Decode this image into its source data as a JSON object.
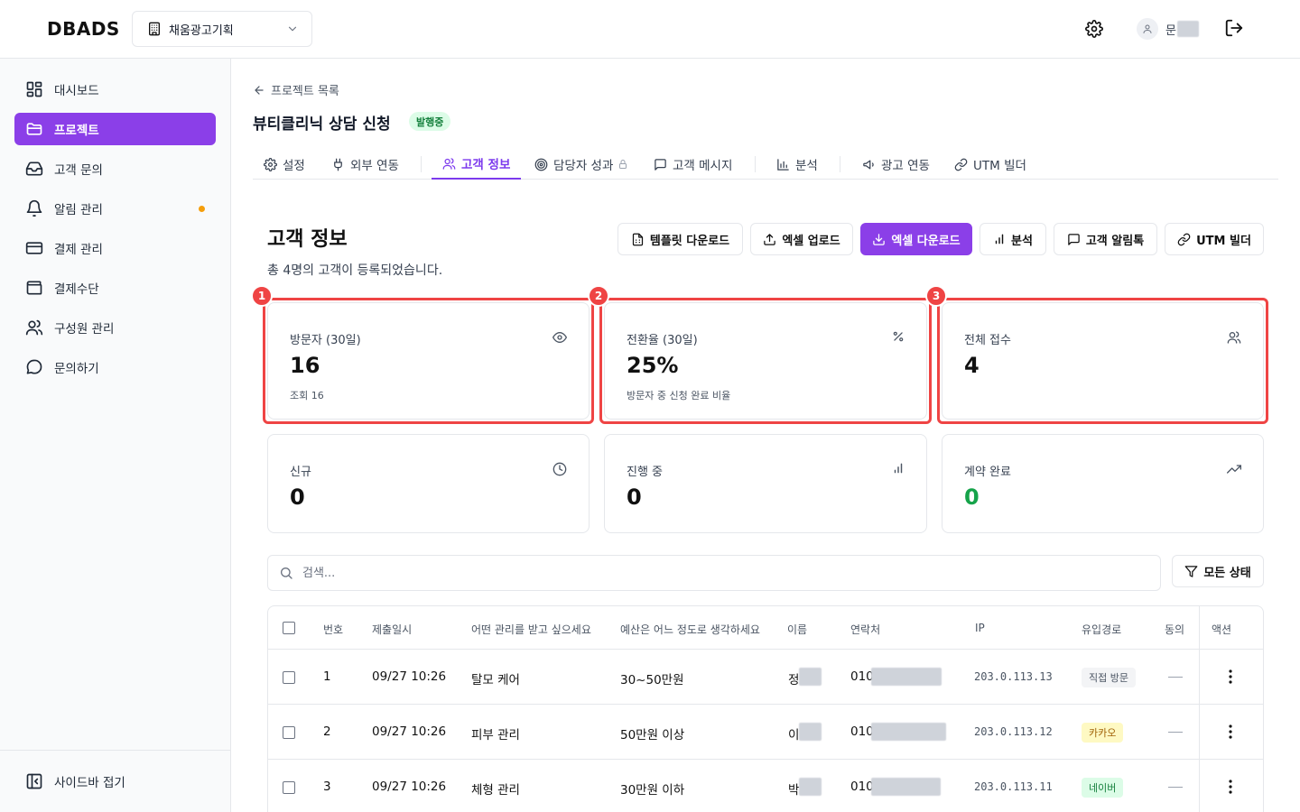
{
  "app": {
    "logo": "DBADS"
  },
  "header": {
    "org_name": "채움광고기획",
    "user_initial": "문"
  },
  "sidebar": {
    "items": [
      {
        "label": "대시보드",
        "icon": "dashboard-icon"
      },
      {
        "label": "프로젝트",
        "icon": "folder-icon",
        "active": true
      },
      {
        "label": "고객 문의",
        "icon": "inbox-icon"
      },
      {
        "label": "알림 관리",
        "icon": "bell-icon",
        "dot": true
      },
      {
        "label": "결제 관리",
        "icon": "card-icon"
      },
      {
        "label": "결제수단",
        "icon": "wallet-icon"
      },
      {
        "label": "구성원 관리",
        "icon": "users-icon"
      },
      {
        "label": "문의하기",
        "icon": "chat-icon"
      }
    ],
    "collapse_label": "사이드바 접기"
  },
  "project": {
    "back_label": "프로젝트 목록",
    "title": "뷰티클리닉 상담 신청",
    "status": "발행중"
  },
  "tabs": [
    {
      "label": "설정"
    },
    {
      "label": "외부 연동"
    },
    {
      "label": "고객 정보",
      "active": true
    },
    {
      "label": "담당자 성과"
    },
    {
      "label": "고객 메시지"
    },
    {
      "label": "분석"
    },
    {
      "label": "광고 연동"
    },
    {
      "label": "UTM 빌더"
    }
  ],
  "section": {
    "title": "고객 정보",
    "subtitle": "총 4명의 고객이 등록되었습니다."
  },
  "actions": {
    "template_download": "템플릿 다운로드",
    "excel_upload": "엑셀 업로드",
    "excel_download": "엑셀 다운로드",
    "analysis": "분석",
    "alimtalk": "고객 알림톡",
    "utm_builder": "UTM 빌더"
  },
  "stats": {
    "visitors": {
      "label": "방문자 (30일)",
      "value": "16",
      "sub": "조회 16"
    },
    "conversion": {
      "label": "전환율 (30일)",
      "value": "25%",
      "sub": "방문자 중 신청 완료 비율"
    },
    "total": {
      "label": "전체 접수",
      "value": "4"
    },
    "new": {
      "label": "신규",
      "value": "0"
    },
    "in_progress": {
      "label": "진행 중",
      "value": "0"
    },
    "contracted": {
      "label": "계약 완료",
      "value": "0"
    }
  },
  "highlights": [
    "1",
    "2",
    "3"
  ],
  "search": {
    "placeholder": "검색..."
  },
  "filter": {
    "label": "모든 상태"
  },
  "table": {
    "headers": {
      "no": "번호",
      "submitted": "제출일시",
      "q1": "어떤 관리를 받고 싶으세요",
      "q2": "예산은 어느 정도로 생각하세요",
      "name": "이름",
      "contact": "연락처",
      "ip": "IP",
      "source": "유입경로",
      "consent": "동의",
      "action": "액션"
    },
    "rows": [
      {
        "no": "1",
        "submitted": "09/27 10:26",
        "q1": "탈모 케어",
        "q2": "30~50만원",
        "name": "정",
        "contact": "010",
        "ip": "203.0.113.13",
        "source": "직접 방문"
      },
      {
        "no": "2",
        "submitted": "09/27 10:26",
        "q1": "피부 관리",
        "q2": "50만원 이상",
        "name": "이",
        "contact": "010",
        "ip": "203.0.113.12",
        "source": "카카오"
      },
      {
        "no": "3",
        "submitted": "09/27 10:26",
        "q1": "체형 관리",
        "q2": "30만원 이하",
        "name": "박",
        "contact": "010",
        "ip": "203.0.113.11",
        "source": "네이버"
      }
    ]
  },
  "colors": {
    "accent": "#8b3fe8",
    "highlight": "#ef4444",
    "badge_live_bg": "#dcfce7",
    "badge_live_fg": "#15803d",
    "kakao_bg": "#fef9c3",
    "naver_bg": "#dcfce7",
    "direct_bg": "#f3f4f6"
  }
}
